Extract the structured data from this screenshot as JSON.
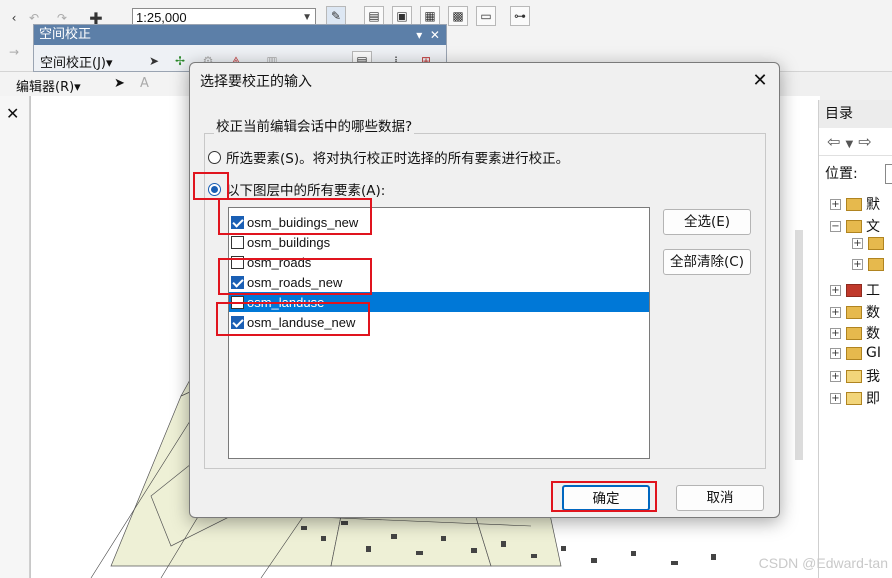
{
  "app": {
    "scale_value": "1:25,000",
    "spatial_toolbar_title": "空间校正",
    "spatial_menu_label": "空间校正(J)▾",
    "editor_menu_label": "编辑器(R)▾"
  },
  "catalog": {
    "title": "目录",
    "location_label": "位置:",
    "items": [
      "默",
      "文",
      "",
      "",
      "工",
      "数",
      "数",
      "GI",
      "我",
      "即"
    ]
  },
  "dialog": {
    "title": "选择要校正的输入",
    "group_label": "校正当前编辑会话中的哪些数据?",
    "option_selected_features": "所选要素(S)。将对执行校正时选择的所有要素进行校正。",
    "option_all_layers": "以下图层中的所有要素(A):",
    "selected_option": "all_layers",
    "layers": [
      {
        "name": "osm_buidings_new",
        "checked": true,
        "selected": false
      },
      {
        "name": "osm_buildings",
        "checked": false,
        "selected": false
      },
      {
        "name": "osm_roads",
        "checked": false,
        "selected": false
      },
      {
        "name": "osm_roads_new",
        "checked": true,
        "selected": false
      },
      {
        "name": "osm_landuse",
        "checked": false,
        "selected": true
      },
      {
        "name": "osm_landuse_new",
        "checked": true,
        "selected": false
      }
    ],
    "select_all_button": "全选(E)",
    "clear_all_button": "全部清除(C)",
    "ok_button": "确定",
    "cancel_button": "取消"
  },
  "watermark": "CSDN @Edward-tan",
  "colors": {
    "accent": "#0078d7",
    "highlight": "#e0141e"
  }
}
